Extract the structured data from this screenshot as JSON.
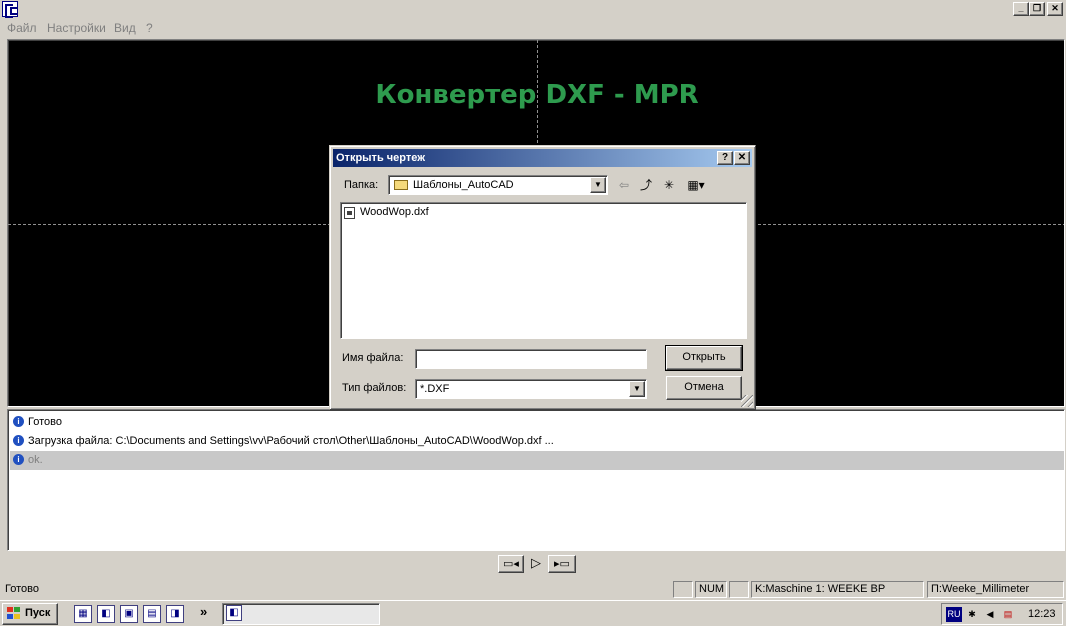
{
  "menu": [
    "Файл",
    "Настройки",
    "Вид",
    "?"
  ],
  "canvas": {
    "title": "Конвертер DXF - MPR",
    "title_color": "#2e9b4e"
  },
  "dialog": {
    "title": "Открыть чертеж",
    "help_label": "?",
    "close_label": "✕",
    "folder_label": "Папка:",
    "folder_value": "Шаблоны_AutoCAD",
    "files": [
      "WoodWop.dxf"
    ],
    "file_name_label": "Имя файла:",
    "file_name_value": "",
    "file_type_label": "Тип файлов:",
    "file_type_value": "*.DXF",
    "open_button": "Открыть",
    "cancel_button": "Отмена"
  },
  "log": [
    {
      "text": "Готово",
      "selected": false
    },
    {
      "text": "Загрузка файла: C:\\Documents and Settings\\vv\\Рабочий стол\\Other\\Шаблоны_AutoCAD\\WoodWop.dxf ...",
      "selected": false
    },
    {
      "text": "ok.",
      "selected": true
    }
  ],
  "statusbar": {
    "text": "Готово",
    "num": "NUM",
    "machine": "K:Maschine 1: WEEKE BP",
    "profile": "П:Weeke_Millimeter"
  },
  "taskbar": {
    "start_label": "Пуск",
    "chevron": "»",
    "lang": "RU",
    "clock": "12:23"
  },
  "icons": {
    "back": "back-arrow-icon",
    "up": "up-folder-icon",
    "new_folder": "new-folder-icon",
    "view_menu": "view-menu-icon",
    "play": "play-icon"
  }
}
